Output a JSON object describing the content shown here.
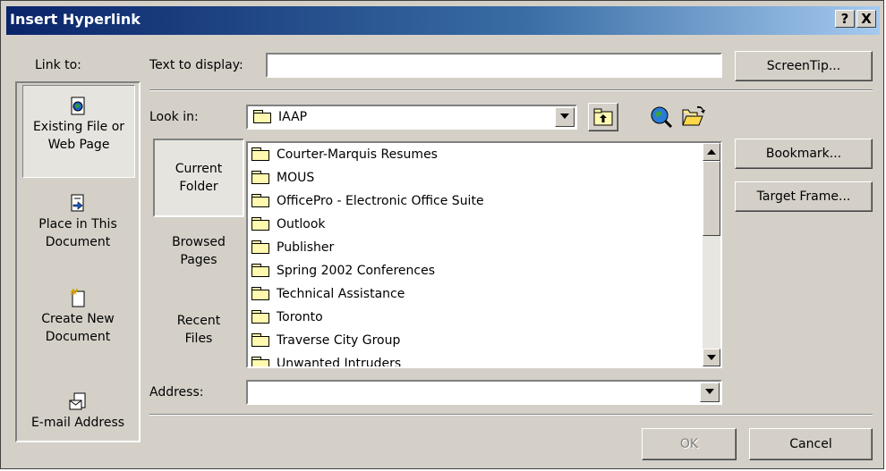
{
  "window": {
    "title": "Insert Hyperlink",
    "help_glyph": "?",
    "close_glyph": "X"
  },
  "link_to": {
    "label": "Link to:",
    "items": [
      {
        "line1": "Existing File or",
        "line2": "Web Page",
        "icon": "existing-file-icon",
        "selected": true
      },
      {
        "line1": "Place in This",
        "line2": "Document",
        "icon": "place-in-document-icon",
        "selected": false
      },
      {
        "line1": "Create New",
        "line2": "Document",
        "icon": "create-new-document-icon",
        "selected": false
      },
      {
        "line1": "E-mail Address",
        "line2": "",
        "icon": "email-address-icon",
        "selected": false
      }
    ]
  },
  "text_to_display": {
    "label": "Text to display:",
    "value": ""
  },
  "screentip_label": "ScreenTip...",
  "look_in": {
    "label": "Look in:",
    "value": "IAAP"
  },
  "browse_tabs": [
    {
      "line1": "Current",
      "line2": "Folder",
      "selected": true
    },
    {
      "line1": "Browsed",
      "line2": "Pages",
      "selected": false
    },
    {
      "line1": "Recent",
      "line2": "Files",
      "selected": false
    }
  ],
  "files": [
    "Courter-Marquis Resumes",
    "MOUS",
    "OfficePro - Electronic Office Suite",
    "Outlook",
    "Publisher",
    "Spring 2002 Conferences",
    "Technical Assistance",
    "Toronto",
    "Traverse City Group",
    "Unwanted Intruders"
  ],
  "bookmark_label": "Bookmark...",
  "target_frame_label": "Target Frame...",
  "address": {
    "label": "Address:",
    "value": ""
  },
  "ok_label": "OK",
  "cancel_label": "Cancel",
  "colors": {
    "dialog_bg": "#d4d0c8",
    "title_start": "#0a246a",
    "title_end": "#a6caf0",
    "folder_fill": "#fff9b0"
  }
}
